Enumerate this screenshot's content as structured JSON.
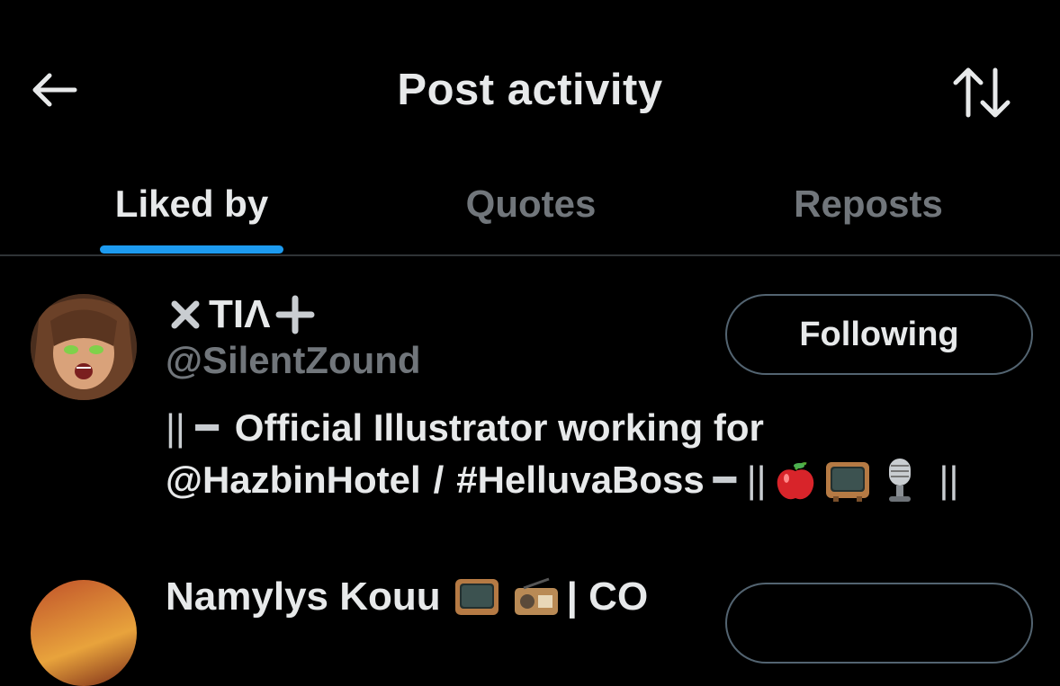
{
  "header": {
    "title": "Post activity",
    "back_icon": "arrow-left-icon",
    "sort_icon": "sort-arrows-icon"
  },
  "tabs": [
    {
      "label": "Liked by",
      "active": true
    },
    {
      "label": "Quotes",
      "active": false
    },
    {
      "label": "Reposts",
      "active": false
    }
  ],
  "accent_color": "#1d9bf0",
  "users": [
    {
      "display_name": "TIΛ",
      "name_prefix_icon": "cross-mark-icon",
      "name_suffix_icon": "plus-icon",
      "handle": "@SilentZound",
      "follow_label": "Following",
      "bio_line1_prefix": "|| ━",
      "bio_line1_text": "Official Illustrator working for",
      "bio_mention": "@HazbinHotel",
      "bio_separator": "/",
      "bio_hashtag": "#HelluvaBoss",
      "bio_line2_suffix": "━ ||",
      "bio_end": "||",
      "bio_emojis": [
        "apple-icon",
        "television-icon",
        "microphone-icon"
      ]
    },
    {
      "display_name": "Namylys Kouu",
      "name_emojis": [
        "television-icon",
        "radio-icon"
      ],
      "name_suffix": "| CO"
    }
  ]
}
